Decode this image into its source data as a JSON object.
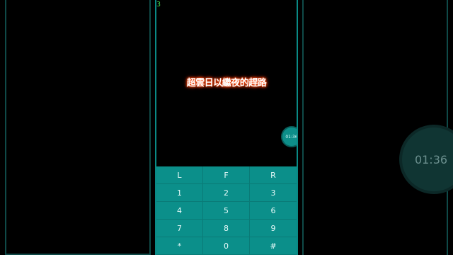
{
  "counter": "3",
  "lyric": "超雲日以繼夜的趕路",
  "timer": "01:36",
  "keypad": {
    "rows": [
      [
        "L",
        "F",
        "R"
      ],
      [
        "1",
        "2",
        "3"
      ],
      [
        "4",
        "5",
        "6"
      ],
      [
        "7",
        "8",
        "9"
      ],
      [
        "*",
        "0",
        "#"
      ]
    ]
  },
  "colors": {
    "keypad_bg": "#0b8f8a",
    "phone_border": "#0a8a86",
    "counter": "#3fd24a",
    "lyric_glow": "#ff3a00"
  }
}
